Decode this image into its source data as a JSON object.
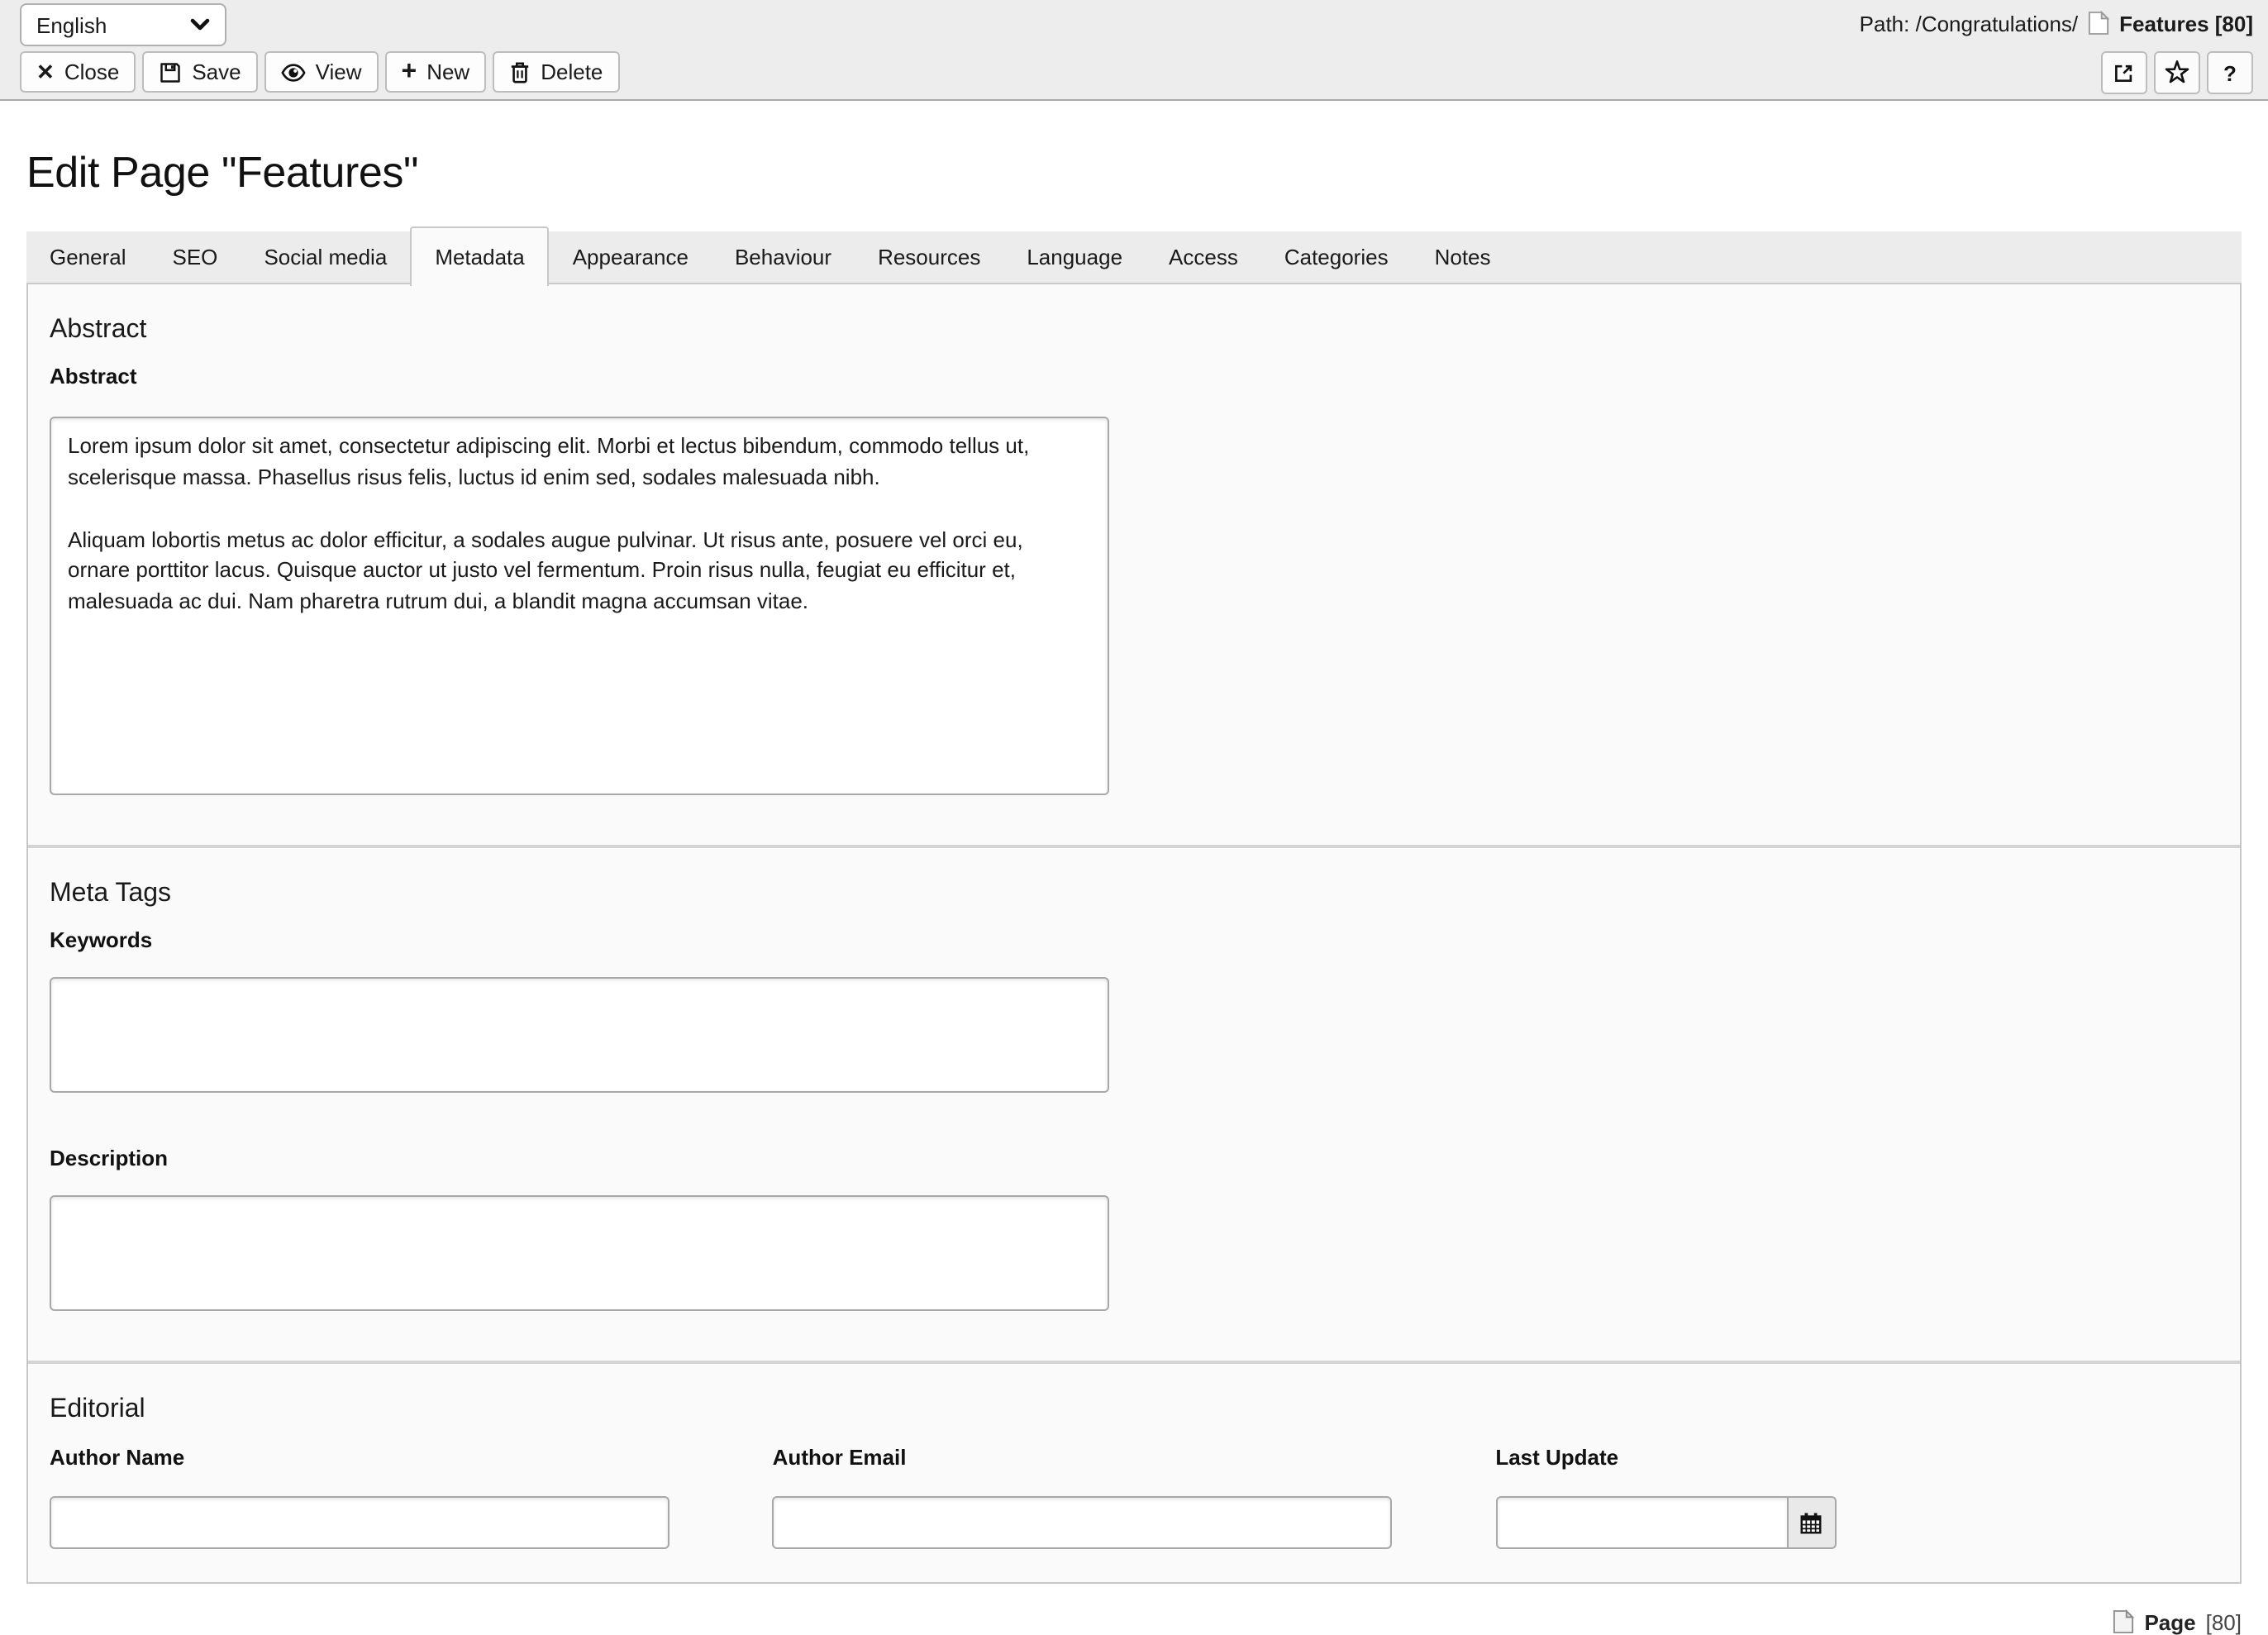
{
  "colors": {
    "toolbar_bg": "#ededed",
    "panel_bg": "#fafafa",
    "tabstrip_bg": "#ececec",
    "border": "#c8c8c8",
    "page_bg": "#ffffff"
  },
  "header": {
    "language": "English",
    "toolbar": {
      "close": "Close",
      "save": "Save",
      "view": "View",
      "new": "New",
      "delete": "Delete"
    },
    "path_prefix": "Path: /Congratulations/",
    "record": "Features [80]",
    "help": "?"
  },
  "page": {
    "title": "Edit Page \"Features\""
  },
  "tabs": [
    "General",
    "SEO",
    "Social media",
    "Metadata",
    "Appearance",
    "Behaviour",
    "Resources",
    "Language",
    "Access",
    "Categories",
    "Notes"
  ],
  "active_tab": "Metadata",
  "sections": {
    "abstract": {
      "heading": "Abstract",
      "field_label": "Abstract",
      "value": "Lorem ipsum dolor sit amet, consectetur adipiscing elit. Morbi et lectus bibendum, commodo tellus ut, scelerisque massa. Phasellus risus felis, luctus id enim sed, sodales malesuada nibh.\n\nAliquam lobortis metus ac dolor efficitur, a sodales augue pulvinar. Ut risus ante, posuere vel orci eu, ornare porttitor lacus. Quisque auctor ut justo vel fermentum. Proin risus nulla, feugiat eu efficitur et, malesuada ac dui. Nam pharetra rutrum dui, a blandit magna accumsan vitae."
    },
    "meta": {
      "heading": "Meta Tags",
      "keywords_label": "Keywords",
      "keywords_value": "",
      "description_label": "Description",
      "description_value": ""
    },
    "editorial": {
      "heading": "Editorial",
      "author_name_label": "Author Name",
      "author_name_value": "",
      "author_email_label": "Author Email",
      "author_email_value": "",
      "last_update_label": "Last Update",
      "last_update_value": ""
    }
  },
  "footer": {
    "record_type": "Page",
    "record_uid": "[80]"
  }
}
